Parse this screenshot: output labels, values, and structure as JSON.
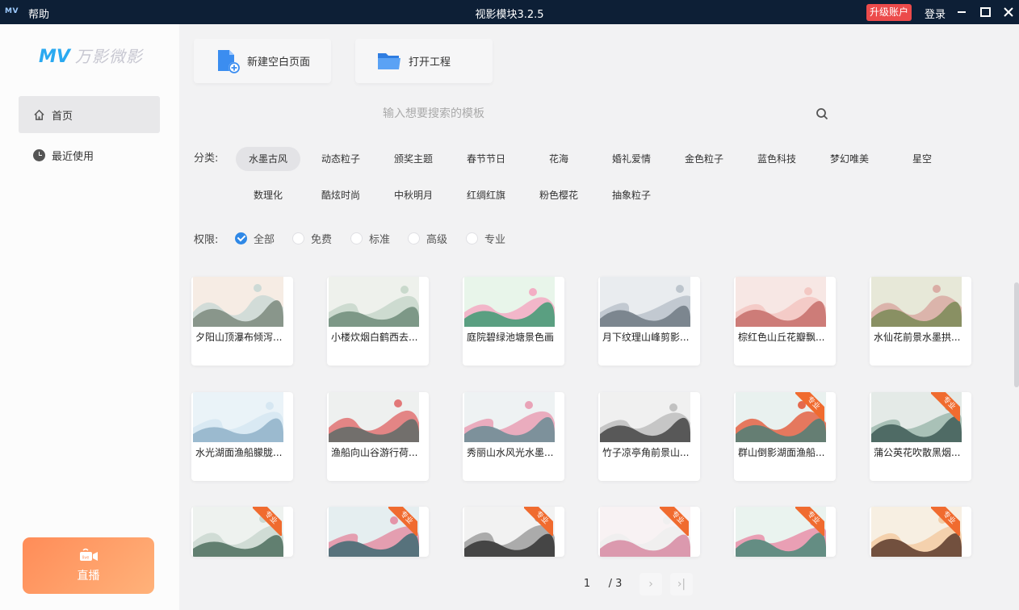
{
  "titlebar": {
    "logo": "MV",
    "help": "帮助",
    "title": "视影模块3.2.5",
    "upgrade": "升级账户",
    "login": "登录"
  },
  "sidebar": {
    "brand_mv": "MV",
    "brand_cn": "万影微影",
    "items": [
      {
        "label": "首页"
      },
      {
        "label": "最近使用"
      }
    ],
    "live_label": "直播"
  },
  "actions": {
    "new_page": "新建空白页面",
    "open_project": "打开工程"
  },
  "search": {
    "placeholder": "输入想要搜索的模板"
  },
  "filters": {
    "category_label": "分类:",
    "categories": [
      "水墨古风",
      "动态粒子",
      "颁奖主题",
      "春节节日",
      "花海",
      "婚礼爱情",
      "金色粒子",
      "蓝色科技",
      "梦幻唯美",
      "星空",
      "数理化",
      "酷炫时尚",
      "中秋明月",
      "红绸红旗",
      "粉色樱花",
      "抽象粒子"
    ],
    "permission_label": "权限:",
    "permissions": [
      "全部",
      "免费",
      "标准",
      "高级",
      "专业"
    ]
  },
  "templates": [
    {
      "title": "夕阳山顶瀑布倾泻..."
    },
    {
      "title": "小楼炊烟白鹤西去..."
    },
    {
      "title": "庭院碧绿池塘景色画"
    },
    {
      "title": "月下纹理山峰剪影..."
    },
    {
      "title": "棕红色山丘花瓣飘..."
    },
    {
      "title": "水仙花前景水墨拱..."
    },
    {
      "title": "水光湖面渔船朦胧..."
    },
    {
      "title": "渔船向山谷游行荷..."
    },
    {
      "title": "秀丽山水风光水墨..."
    },
    {
      "title": "竹子凉亭角前景山..."
    },
    {
      "title": "群山倒影湖面渔船...",
      "badge": "专业"
    },
    {
      "title": "蒲公英花吹散黑烟...",
      "badge": "专业"
    },
    {
      "title": "",
      "badge": "专业"
    },
    {
      "title": "",
      "badge": "专业"
    },
    {
      "title": "",
      "badge": "专业"
    },
    {
      "title": "",
      "badge": "专业"
    },
    {
      "title": "",
      "badge": "专业"
    },
    {
      "title": "",
      "badge": "专业"
    }
  ],
  "pagination": {
    "current": "1",
    "total": "/ 3",
    "next": "›",
    "last": "›|"
  },
  "colors": {
    "titlebar_bg": "#0d1f36",
    "upgrade_bg": "#ec4b4b",
    "brand": "#2aa9f0",
    "check": "#2f88e6",
    "live_gradient_start": "#ff8c58",
    "badge": "#f06b2f"
  }
}
